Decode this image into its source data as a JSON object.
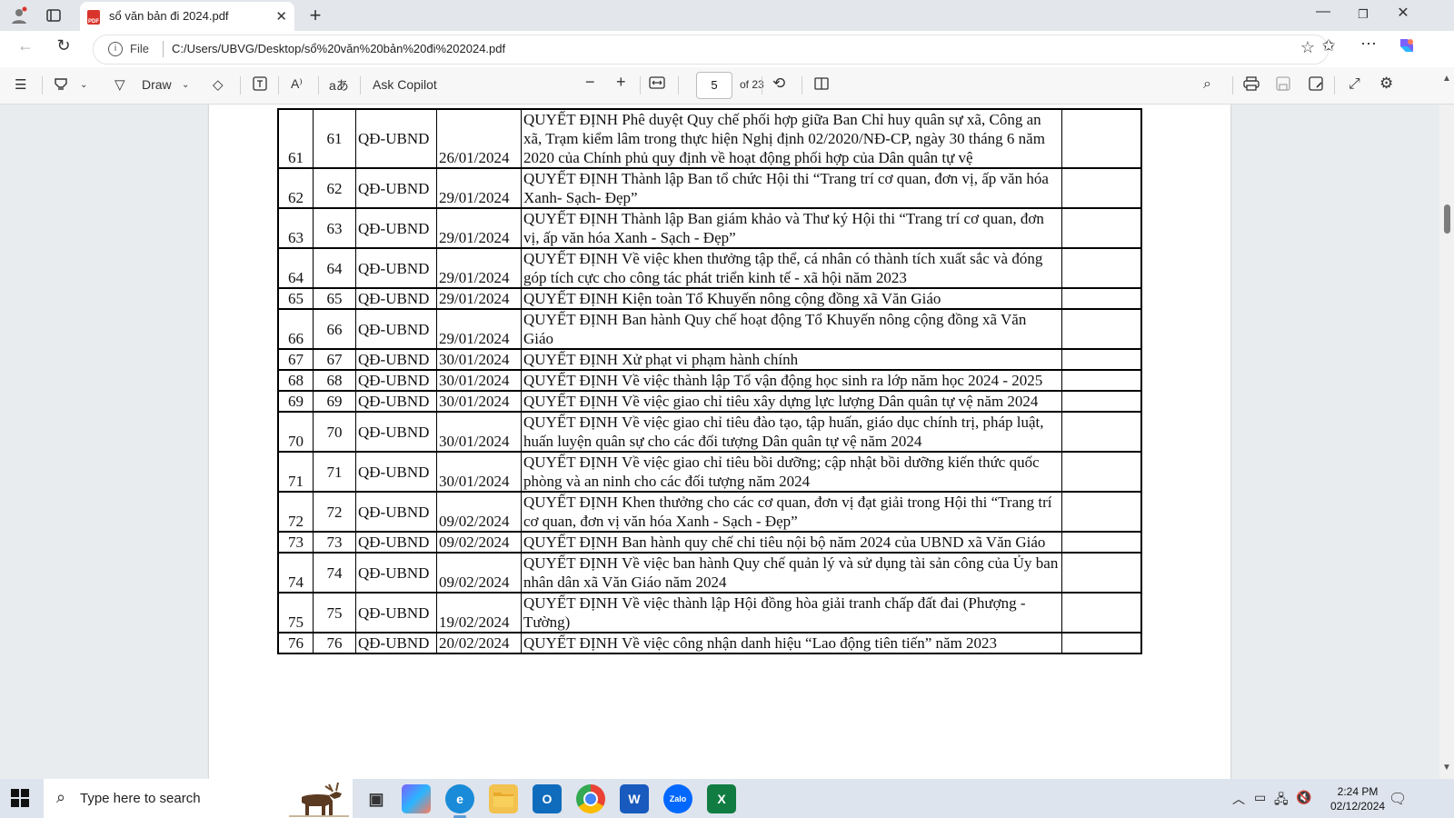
{
  "browser": {
    "tab_title": "sổ văn bản đi 2024.pdf",
    "address_prefix": "File",
    "url": "C:/Users/UBVG/Desktop/sổ%20văn%20bản%20đi%202024.pdf"
  },
  "pdf_toolbar": {
    "draw_label": "Draw",
    "ask_copilot_label": "Ask Copilot",
    "page_number": "5",
    "page_total": "of 23"
  },
  "table": {
    "rows": [
      {
        "stt": "61",
        "so": "61",
        "loai": "QĐ-UBND",
        "ngay": "26/01/2024",
        "trich_yeu": "QUYẾT ĐỊNH Phê duyệt Quy chế phối hợp giữa Ban Chỉ huy quân sự xã, Công an xã, Trạm kiểm lâm trong thực hiện Nghị định 02/2020/NĐ-CP, ngày 30 tháng 6 năm 2020 của Chính phủ quy định về hoạt động phối hợp của Dân quân tự vệ"
      },
      {
        "stt": "62",
        "so": "62",
        "loai": "QĐ-UBND",
        "ngay": "29/01/2024",
        "trich_yeu": "QUYẾT ĐỊNH Thành lập Ban tổ chức Hội thi “Trang trí cơ quan, đơn vị, ấp văn hóa Xanh- Sạch- Đẹp”"
      },
      {
        "stt": "63",
        "so": "63",
        "loai": "QĐ-UBND",
        "ngay": "29/01/2024",
        "trich_yeu": "QUYẾT ĐỊNH Thành lập Ban giám khảo và Thư ký Hội thi “Trang trí cơ quan, đơn vị, ấp văn hóa Xanh - Sạch - Đẹp”"
      },
      {
        "stt": "64",
        "so": "64",
        "loai": "QĐ-UBND",
        "ngay": "29/01/2024",
        "trich_yeu": "QUYẾT ĐỊNH Về việc khen thưởng tập thể, cá nhân có thành tích xuất sắc và đóng góp tích cực cho công tác phát triển kinh tế - xã hội năm 2023"
      },
      {
        "stt": "65",
        "so": "65",
        "loai": "QĐ-UBND",
        "ngay": "29/01/2024",
        "trich_yeu": "QUYẾT ĐỊNH Kiện toàn Tổ Khuyến nông cộng đồng xã Văn Giáo"
      },
      {
        "stt": "66",
        "so": "66",
        "loai": "QĐ-UBND",
        "ngay": "29/01/2024",
        "trich_yeu": "QUYẾT ĐỊNH Ban hành Quy chế hoạt động Tổ Khuyến nông cộng đồng xã Văn Giáo"
      },
      {
        "stt": "67",
        "so": "67",
        "loai": "QĐ-UBND",
        "ngay": "30/01/2024",
        "trich_yeu": "QUYẾT ĐỊNH Xử phạt vi phạm hành chính"
      },
      {
        "stt": "68",
        "so": "68",
        "loai": "QĐ-UBND",
        "ngay": "30/01/2024",
        "trich_yeu": "QUYẾT ĐỊNH Về việc thành lập Tổ vận động học sinh ra lớp năm học 2024 - 2025"
      },
      {
        "stt": "69",
        "so": "69",
        "loai": "QĐ-UBND",
        "ngay": "30/01/2024",
        "trich_yeu": " QUYẾT ĐỊNH Về việc giao chỉ tiêu xây dựng lực lượng Dân quân tự vệ năm 2024"
      },
      {
        "stt": "70",
        "so": "70",
        "loai": "QĐ-UBND",
        "ngay": "30/01/2024",
        "trich_yeu": "QUYẾT ĐỊNH Về việc giao chỉ tiêu đào tạo, tập huấn, giáo dục chính trị, pháp luật, huấn luyện quân sự cho các đối tượng Dân quân tự vệ năm 2024"
      },
      {
        "stt": "71",
        "so": "71",
        "loai": "QĐ-UBND",
        "ngay": "30/01/2024",
        "trich_yeu": "QUYẾT ĐỊNH Về việc giao chỉ tiêu bồi dưỡng; cập nhật bồi dưỡng kiến thức quốc phòng và an ninh cho các đối tượng năm 2024"
      },
      {
        "stt": "72",
        "so": "72",
        "loai": "QĐ-UBND",
        "ngay": "09/02/2024",
        "trich_yeu": "QUYẾT ĐỊNH Khen thưởng cho các cơ quan, đơn vị đạt giải trong Hội thi “Trang trí cơ quan, đơn vị văn hóa Xanh - Sạch - Đẹp”"
      },
      {
        "stt": "73",
        "so": "73",
        "loai": "QĐ-UBND",
        "ngay": "09/02/2024",
        "trich_yeu": "QUYẾT ĐỊNH Ban hành quy chế chi tiêu nội bộ năm 2024 của UBND xã Văn Giáo"
      },
      {
        "stt": "74",
        "so": "74",
        "loai": "QĐ-UBND",
        "ngay": "09/02/2024",
        "trich_yeu": "QUYẾT ĐỊNH Về việc ban hành Quy chế quản lý và sử dụng tài sản công của Ủy ban nhân dân xã Văn Giáo năm 2024"
      },
      {
        "stt": "75",
        "so": "75",
        "loai": "QĐ-UBND",
        "ngay": "19/02/2024",
        "trich_yeu": "QUYẾT ĐỊNH Về việc thành lập Hội đồng hòa giải tranh chấp đất đai (Phượng - Tường)"
      },
      {
        "stt": "76",
        "so": "76",
        "loai": "QĐ-UBND",
        "ngay": "20/02/2024",
        "trich_yeu": "QUYẾT ĐỊNH Về việc công nhận danh hiệu “Lao động tiên tiến” năm 2023"
      }
    ]
  },
  "taskbar": {
    "search_placeholder": "Type here to search",
    "time": "2:24 PM",
    "date": "02/12/2024",
    "apps": [
      "copilot",
      "edge",
      "file-explorer",
      "outlook",
      "chrome",
      "word",
      "zalo",
      "excel"
    ]
  },
  "colors": {
    "pdf_red": "#d9342b",
    "word_blue": "#185abd",
    "excel_green": "#107c41",
    "edge_blue": "#1a8bd8",
    "zalo_blue": "#0068ff"
  }
}
